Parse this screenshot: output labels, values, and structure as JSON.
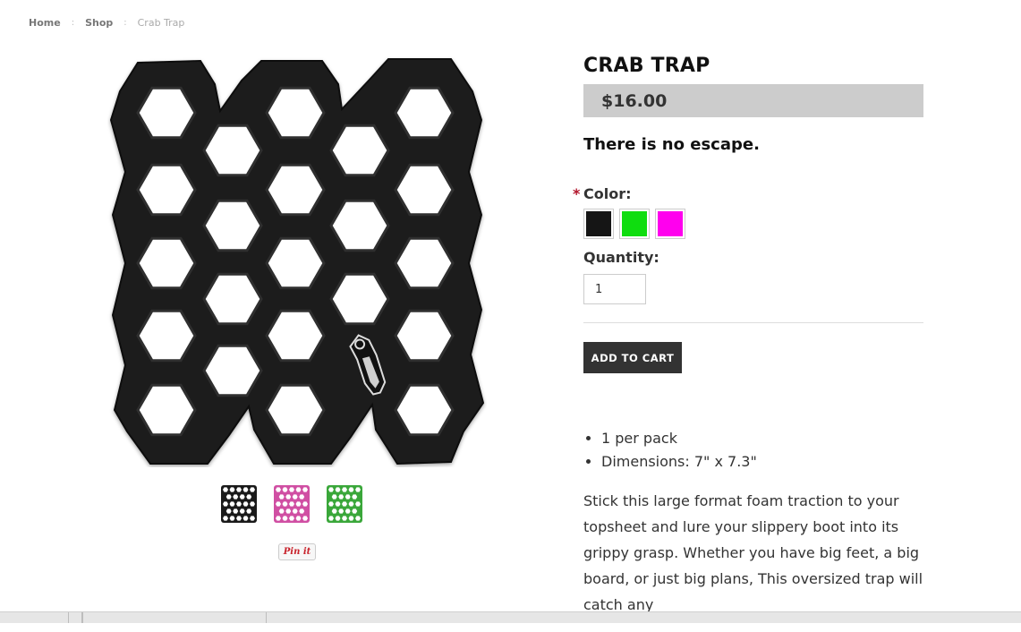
{
  "breadcrumb": {
    "home": "Home",
    "shop": "Shop",
    "current": "Crab Trap",
    "sep": ":"
  },
  "images": {
    "main_alt": "Crab Trap",
    "thumbnails": [
      {
        "name": "thumbnail-black",
        "color": "#1a1a1a"
      },
      {
        "name": "thumbnail-pink",
        "color": "#d04fa3"
      },
      {
        "name": "thumbnail-green",
        "color": "#3aa73a"
      }
    ],
    "pin_label": "Pin it"
  },
  "product": {
    "title": "CRAB TRAP",
    "price": "$16.00",
    "tagline": "There is no escape.",
    "color_label": "Color:",
    "required_mark": "*",
    "colors": [
      {
        "name": "swatch-black",
        "hex": "#151515"
      },
      {
        "name": "swatch-green",
        "hex": "#0fdd0f"
      },
      {
        "name": "swatch-magenta",
        "hex": "#ff00ee"
      }
    ],
    "quantity_label": "Quantity:",
    "quantity_value": "1",
    "add_to_cart": "ADD TO CART",
    "features": [
      "1 per pack",
      "Dimensions: 7\" x 7.3\""
    ],
    "description": "Stick this large format foam traction to your topsheet and lure your slippery boot into its grippy grasp. Whether you have big feet, a big board, or just big plans, This oversized trap will catch any"
  }
}
